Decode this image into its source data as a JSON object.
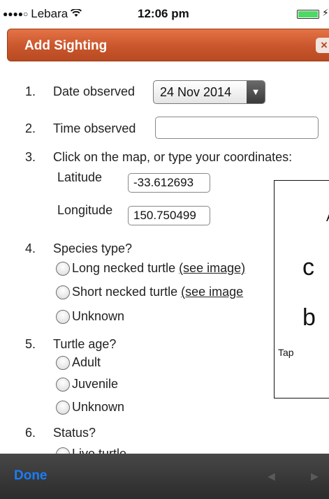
{
  "status_bar": {
    "signal": "●●●●○",
    "carrier": "Lebara",
    "wifi_icon": "wifi-icon",
    "time": "12:06 pm",
    "battery_icon": "battery-icon",
    "charging_icon": "⚡"
  },
  "header": {
    "title": "Add Sighting",
    "close_label": "×"
  },
  "form": {
    "q1": {
      "num": "1.",
      "label": "Date observed",
      "date_value": "24 Nov 2014",
      "arrow": "▼"
    },
    "q2": {
      "num": "2.",
      "label": "Time observed",
      "value": ""
    },
    "q3": {
      "num": "3.",
      "label": "Click on the map, or type your coordinates:",
      "latitude_label": "Latitude",
      "latitude_value": "-33.612693",
      "longitude_label": "Longitude",
      "longitude_value": "150.750499"
    },
    "q4": {
      "num": "4.",
      "label": "Species type?",
      "options": [
        {
          "label": "Long necked turtle",
          "link": "(see image)"
        },
        {
          "label": "Short necked turtle",
          "link": "(see image"
        },
        {
          "label": "Unknown",
          "link": ""
        }
      ]
    },
    "q5": {
      "num": "5.",
      "label": "Turtle age?",
      "options": [
        "Adult",
        "Juvenile",
        "Unknown"
      ]
    },
    "q6": {
      "num": "6.",
      "label": "Status?",
      "options": [
        "Live turtle"
      ]
    }
  },
  "popup": {
    "line1": "A",
    "line2": "c",
    "line3": "b",
    "line4": "Tap"
  },
  "toolbar": {
    "done_label": "Done",
    "prev_label": "◀",
    "next_label": "▶"
  },
  "colors": {
    "header": "#c9562c",
    "done": "#1a7dfa",
    "toolbar": "#2c2c2c"
  }
}
